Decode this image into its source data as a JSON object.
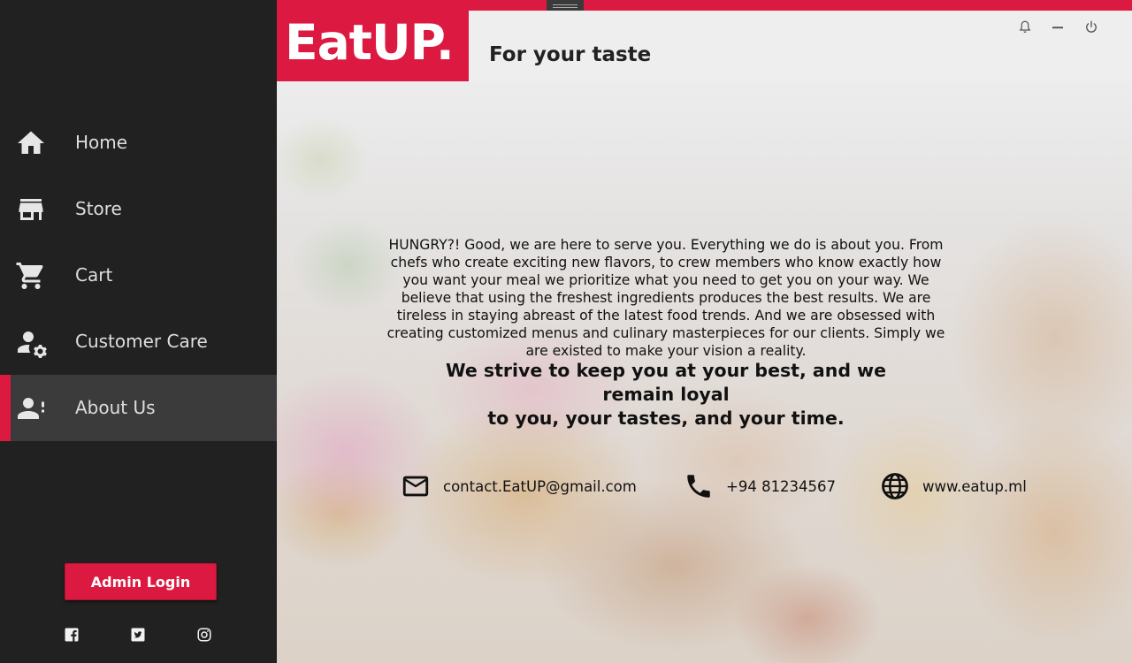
{
  "sidebar": {
    "items": [
      {
        "label": "Home",
        "icon": "home-icon",
        "active": false
      },
      {
        "label": "Store",
        "icon": "store-icon",
        "active": false
      },
      {
        "label": "Cart",
        "icon": "cart-icon",
        "active": false
      },
      {
        "label": "Customer Care",
        "icon": "account-cog-icon",
        "active": false
      },
      {
        "label": "About Us",
        "icon": "account-alert-icon",
        "active": true
      }
    ],
    "admin_login_label": "Admin Login",
    "social": [
      "facebook-icon",
      "twitter-icon",
      "instagram-icon"
    ]
  },
  "header": {
    "logo": "EatUP.",
    "tagline": "For your taste",
    "window_controls": [
      "bell-icon",
      "minimize-icon",
      "power-icon"
    ]
  },
  "main": {
    "about_text": "HUNGRY?! Good, we are here to serve you. Everything we do is about you. From chefs who create exciting new flavors, to crew members who know exactly how you want your meal we prioritize what you need to get you on your way. We believe that using the freshest ingredients produces the best results. We are tireless in staying abreast of the latest food trends. And we are obsessed with creating customized menus and culinary masterpieces for our clients. Simply we are existed to make your vision a reality.",
    "motto_line1": "We strive to keep you at your best, and we remain loyal",
    "motto_line2": "to you, your tastes, and your time.",
    "contacts": {
      "email": "contact.EatUP@gmail.com",
      "phone": "+94 81234567",
      "website": "www.eatup.ml"
    }
  },
  "colors": {
    "accent": "#dc1a41",
    "sidebar_bg": "#212121",
    "sidebar_active": "#3b3b3b"
  }
}
